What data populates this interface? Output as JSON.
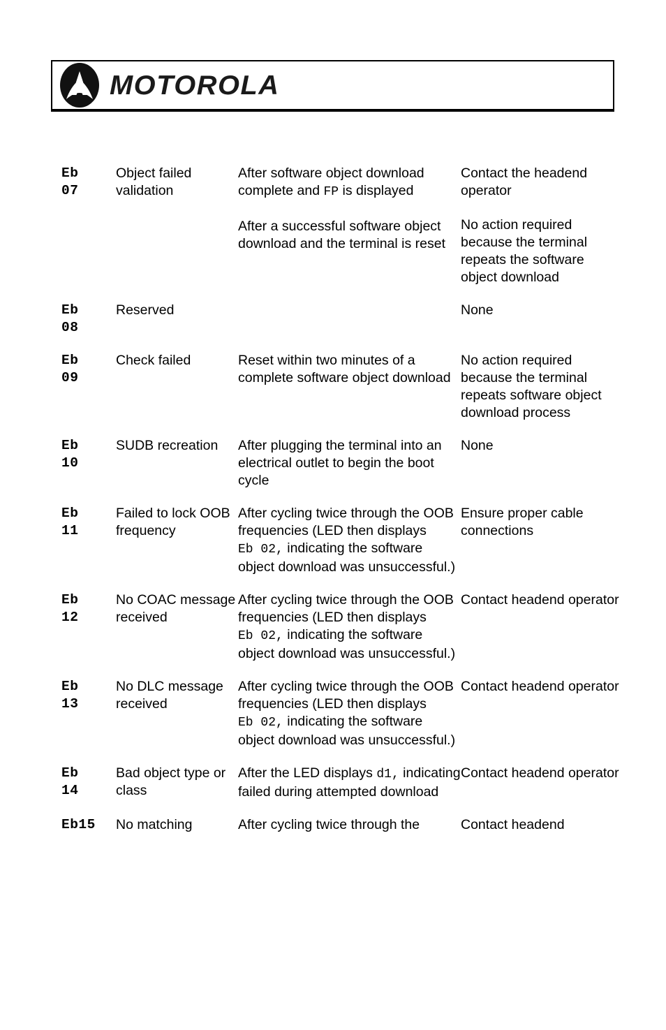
{
  "header": {
    "brand": "MOTOROLA",
    "logo_icon": "motorola-batwing-icon"
  },
  "table": {
    "rows": [
      {
        "code_lines": [
          "Eb",
          "07"
        ],
        "name": "Object failed validation",
        "when": [
          {
            "parts": [
              {
                "text": "After software object download complete and ",
                "mono": false
              },
              {
                "text": "FP",
                "mono": true
              },
              {
                "text": " is displayed",
                "mono": false
              }
            ]
          },
          {
            "parts": [
              {
                "text": "After a successful software object download and the terminal is reset",
                "mono": false
              }
            ]
          }
        ],
        "action": [
          {
            "parts": [
              {
                "text": "Contact the headend operator",
                "mono": false
              }
            ]
          },
          {
            "parts": [
              {
                "text": "No action required because the terminal repeats the software object download",
                "mono": false
              }
            ]
          }
        ]
      },
      {
        "code_lines": [
          "Eb",
          "08"
        ],
        "name": "Reserved",
        "when": [],
        "action": [
          {
            "parts": [
              {
                "text": "None",
                "mono": false
              }
            ]
          }
        ]
      },
      {
        "code_lines": [
          "Eb",
          "09"
        ],
        "name": "Check failed",
        "when": [
          {
            "parts": [
              {
                "text": "Reset within two minutes of a complete software object download",
                "mono": false
              }
            ]
          }
        ],
        "action": [
          {
            "parts": [
              {
                "text": "No action required because the terminal repeats software object download process",
                "mono": false
              }
            ]
          }
        ]
      },
      {
        "code_lines": [
          "Eb",
          "10"
        ],
        "name": "SUDB recreation",
        "when": [
          {
            "parts": [
              {
                "text": "After plugging the terminal into an electrical outlet to begin the boot cycle",
                "mono": false
              }
            ]
          }
        ],
        "action": [
          {
            "parts": [
              {
                "text": "None",
                "mono": false
              }
            ]
          }
        ]
      },
      {
        "code_lines": [
          "Eb",
          "11"
        ],
        "name": "Failed to lock OOB frequency",
        "when": [
          {
            "parts": [
              {
                "text": "After cycling twice through the OOB frequencies (LED then displays ",
                "mono": false
              },
              {
                "text": "Eb 02,",
                "mono": true
              },
              {
                "text": " indicating the software object download was unsuccessful.)",
                "mono": false
              }
            ]
          }
        ],
        "action": [
          {
            "parts": [
              {
                "text": "Ensure proper cable connections",
                "mono": false
              }
            ]
          }
        ]
      },
      {
        "code_lines": [
          "Eb",
          "12"
        ],
        "name": "No COAC message received",
        "when": [
          {
            "parts": [
              {
                "text": "After cycling twice through the OOB frequencies (LED then displays ",
                "mono": false
              },
              {
                "text": "Eb 02,",
                "mono": true
              },
              {
                "text": " indicating the software object download was unsuccessful.)",
                "mono": false
              }
            ]
          }
        ],
        "action": [
          {
            "parts": [
              {
                "text": "Contact headend operator",
                "mono": false
              }
            ]
          }
        ]
      },
      {
        "code_lines": [
          "Eb",
          "13"
        ],
        "name": "No DLC message received",
        "when": [
          {
            "parts": [
              {
                "text": "After cycling twice through the OOB frequencies (LED then displays ",
                "mono": false
              },
              {
                "text": "Eb 02,",
                "mono": true
              },
              {
                "text": " indicating the software object download was unsuccessful.)",
                "mono": false
              }
            ]
          }
        ],
        "action": [
          {
            "parts": [
              {
                "text": "Contact headend operator",
                "mono": false
              }
            ]
          }
        ]
      },
      {
        "code_lines": [
          "Eb",
          "14"
        ],
        "name": "Bad object type or class",
        "when": [
          {
            "parts": [
              {
                "text": "After the LED displays ",
                "mono": false
              },
              {
                "text": "d1,",
                "mono": true
              },
              {
                "text": " indicating failed during attempted download",
                "mono": false
              }
            ]
          }
        ],
        "action": [
          {
            "parts": [
              {
                "text": "Contact headend operator",
                "mono": false
              }
            ]
          }
        ]
      },
      {
        "code_lines": [
          "Eb15"
        ],
        "name": "No matching",
        "when": [
          {
            "parts": [
              {
                "text": "After cycling twice through the",
                "mono": false
              }
            ]
          }
        ],
        "action": [
          {
            "parts": [
              {
                "text": "Contact headend",
                "mono": false
              }
            ]
          }
        ]
      }
    ]
  }
}
